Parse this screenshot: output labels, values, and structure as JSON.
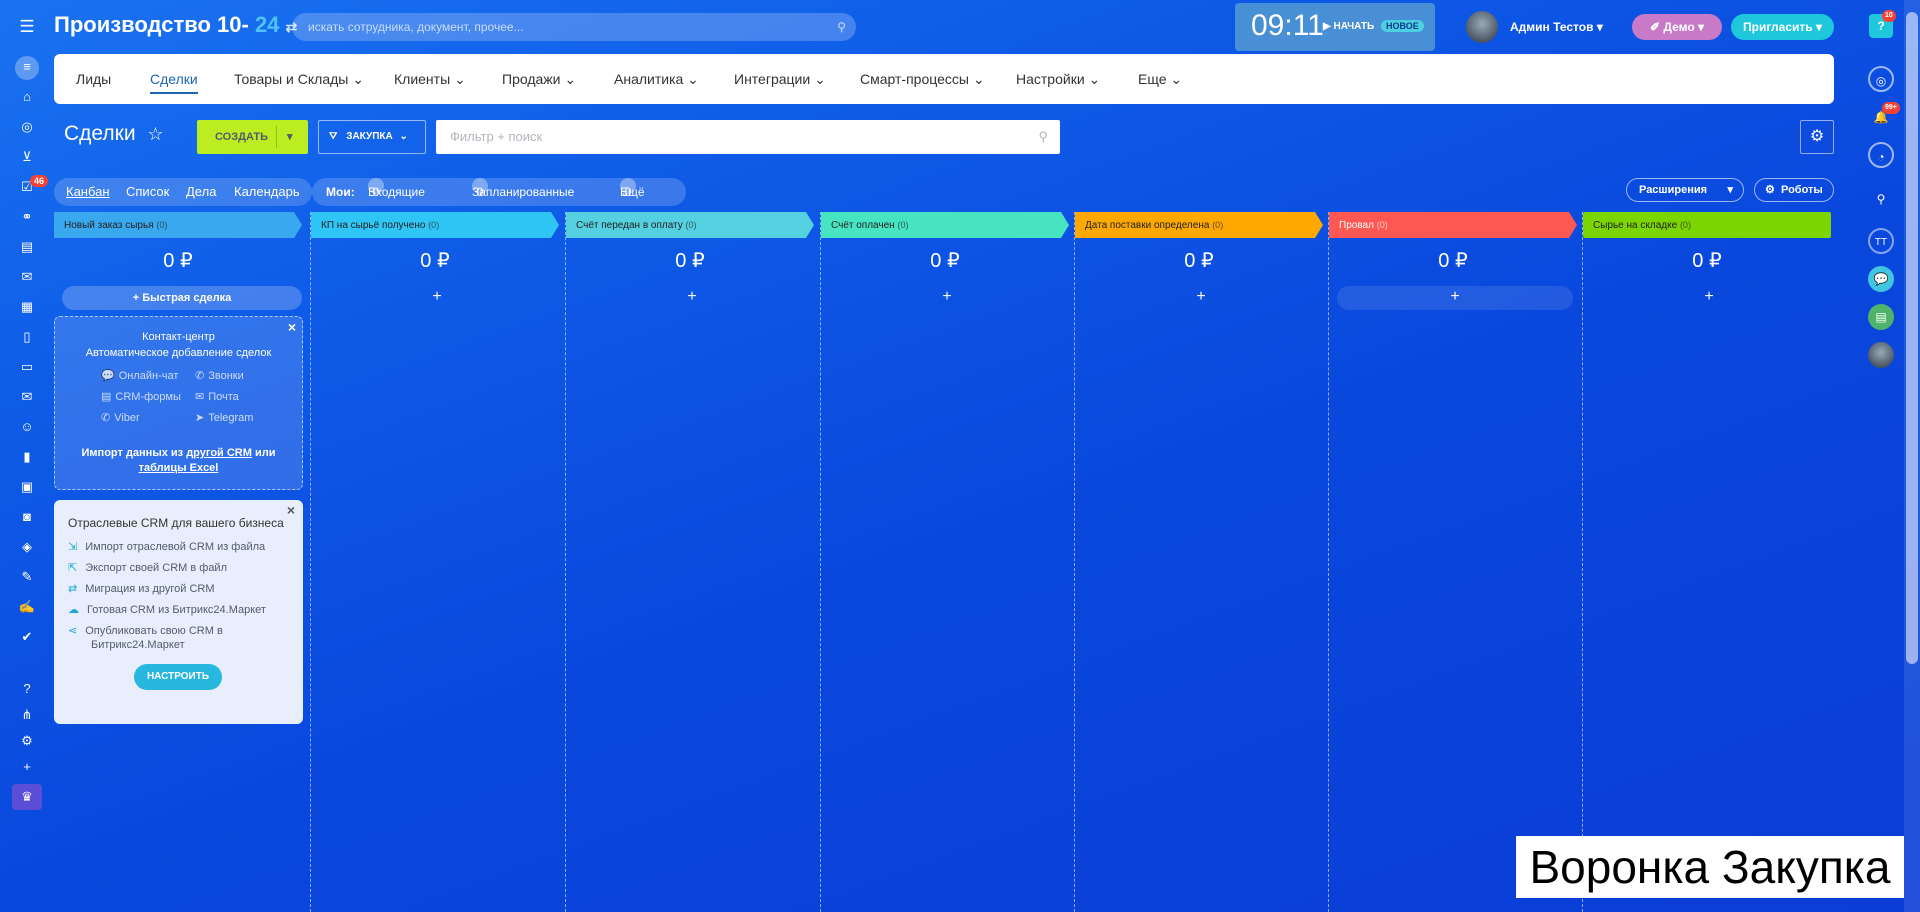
{
  "header": {
    "brand": "Производство 10-",
    "brand_suffix": "24",
    "search_placeholder": "искать сотрудника, документ, прочее...",
    "clock": "09:11",
    "start_label": "НАЧАТЬ",
    "new_badge": "НОВОЕ",
    "user_name": "Админ Тестов",
    "demo_label": "Демо",
    "invite_label": "Пригласить",
    "help_badge": "10"
  },
  "nav": {
    "items": [
      "Лиды",
      "Сделки",
      "Товары и Склады",
      "Клиенты",
      "Продажи",
      "Аналитика",
      "Интеграции",
      "Смарт-процессы",
      "Настройки",
      "Еще"
    ]
  },
  "toolbar": {
    "title": "Сделки",
    "create_label": "СОЗДАТЬ",
    "pipeline_label": "ЗАКУПКА",
    "filter_placeholder": "Фильтр + поиск"
  },
  "views": {
    "tabs": [
      "Канбан",
      "Список",
      "Дела",
      "Календарь"
    ],
    "mine_label": "Мои:",
    "incoming_count": "0",
    "incoming_label": "Входящие",
    "planned_count": "0",
    "planned_label": "Запланированные",
    "more_count": "0",
    "more_label": "Ещё",
    "extensions_label": "Расширения",
    "robots_label": "Роботы"
  },
  "columns": [
    {
      "title": "Новый заказ сырья",
      "count": "(0)",
      "sum": "0 ₽",
      "color": "#39a8ef"
    },
    {
      "title": "КП на сырьё получено",
      "count": "(0)",
      "sum": "0 ₽",
      "color": "#2fc6f6"
    },
    {
      "title": "Счёт передан в оплату",
      "count": "(0)",
      "sum": "0 ₽",
      "color": "#55d0e0"
    },
    {
      "title": "Счёт оплачен",
      "count": "(0)",
      "sum": "0 ₽",
      "color": "#47e4c2"
    },
    {
      "title": "Дата поставки определена",
      "count": "(0)",
      "sum": "0 ₽",
      "color": "#ffa900"
    },
    {
      "title": "Провал",
      "count": "(0)",
      "sum": "0 ₽",
      "color": "#ff5752"
    },
    {
      "title": "Сырье на складке",
      "count": "(0)",
      "sum": "0 ₽",
      "color": "#7bd500"
    }
  ],
  "quick_deal_label": "Быстрая сделка",
  "contact_center": {
    "title": "Контакт-центр",
    "subtitle": "Автоматическое добавление сделок",
    "channels": [
      "Онлайн-чат",
      "Звонки",
      "CRM-формы",
      "Почта",
      "Viber",
      "Telegram"
    ],
    "import_text": "Импорт данных из",
    "import_link1": "другой CRM",
    "import_or": "или",
    "import_link2": "таблицы Excel"
  },
  "industry": {
    "title": "Отраслевые CRM для вашего бизнеса",
    "items": [
      "Импорт отраслевой CRM из файла",
      "Экспорт своей CRM в файл",
      "Миграция из другой CRM",
      "Готовая CRM из Битрикс24.Маркет",
      "Опубликовать свою CRM в",
      "Битрикс24.Маркет"
    ],
    "setup_label": "НАСТРОИТЬ"
  },
  "sidebar_badge": "46",
  "right_bar": {
    "notif_badge": "99+",
    "user_initials": "ТТ"
  },
  "caption": "Воронка Закупка"
}
